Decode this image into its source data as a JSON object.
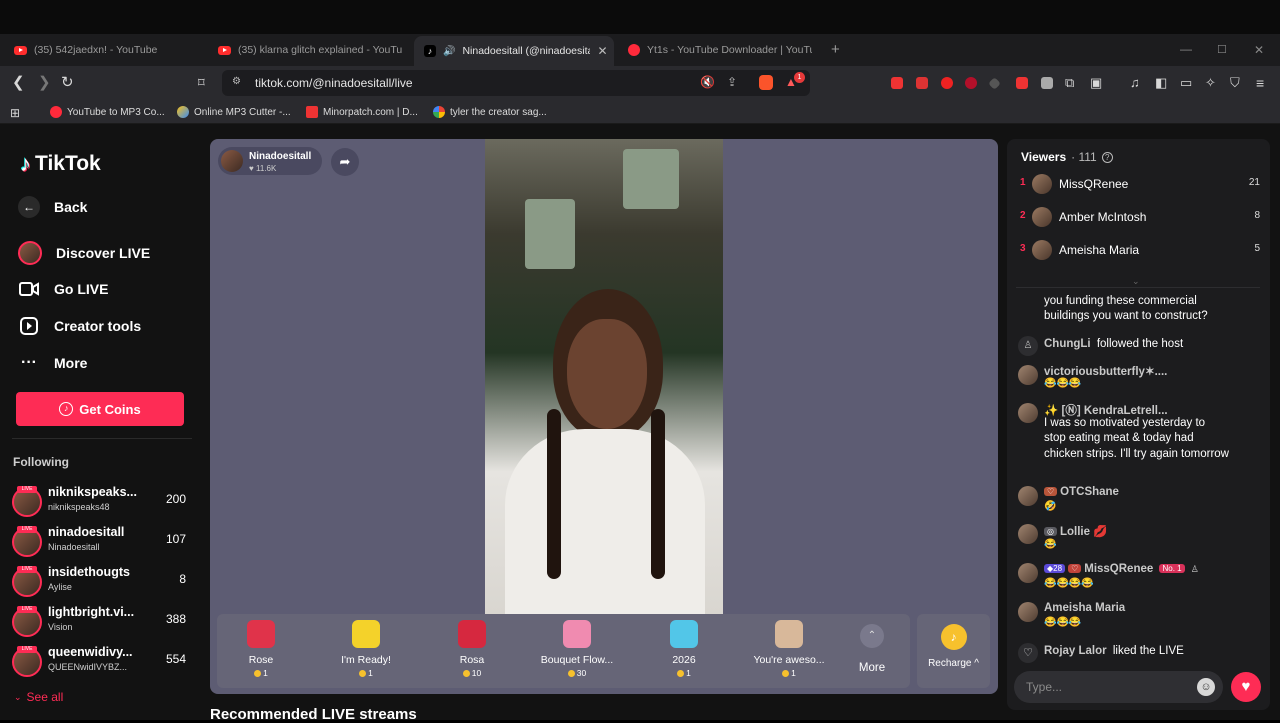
{
  "browser": {
    "tabs": [
      {
        "label": "(35) 542jaedxn! - YouTube"
      },
      {
        "label": "(35) klarna glitch explained - YouTube"
      },
      {
        "label": "Ninadoesitall (@ninadoesitall)"
      },
      {
        "label": "Yt1s - YouTube Downloader | YouTube"
      }
    ],
    "url": "tiktok.com/@ninadoesitall/live",
    "bookmarks": [
      {
        "label": "YouTube to MP3 Co..."
      },
      {
        "label": "Online MP3 Cutter -..."
      },
      {
        "label": "Minorpatch.com | D..."
      },
      {
        "label": "tyler the creator sag..."
      }
    ],
    "ext_badge": "1"
  },
  "sidebar": {
    "logo": "TikTok",
    "nav": [
      {
        "label": "Back"
      },
      {
        "label": "Discover LIVE"
      },
      {
        "label": "Go LIVE"
      },
      {
        "label": "Creator tools"
      },
      {
        "label": "More"
      }
    ],
    "coins_button": "Get Coins",
    "following_title": "Following",
    "following": [
      {
        "name": "niknikspeaks...",
        "sub": "niknikspeaks48",
        "count": "200"
      },
      {
        "name": "ninadoesitall",
        "sub": "Ninadoesitall",
        "count": "107"
      },
      {
        "name": "insidethougts",
        "sub": "Aylise",
        "count": "8"
      },
      {
        "name": "lightbright.vi...",
        "sub": "Vision",
        "count": "388"
      },
      {
        "name": "queenwidivy...",
        "sub": "QUEENwidIVYBZ...",
        "count": "554"
      }
    ],
    "see_all": "See all",
    "live_badge": "LIVE"
  },
  "stream": {
    "host_name": "Ninadoesitall",
    "host_likes": "11.6K",
    "gifts": [
      {
        "name": "Rose",
        "price": "1",
        "color": "#e0334a"
      },
      {
        "name": "I'm Ready!",
        "price": "1",
        "color": "#f4d22a"
      },
      {
        "name": "Rosa",
        "price": "10",
        "color": "#d6283f"
      },
      {
        "name": "Bouquet Flow...",
        "price": "30",
        "color": "#f08bb0"
      },
      {
        "name": "2026",
        "price": "1",
        "color": "#52c6e8"
      },
      {
        "name": "You're aweso...",
        "price": "1",
        "color": "#d8b89a"
      }
    ],
    "more_label": "More",
    "recharge_label": "Recharge ^",
    "recommended_title": "Recommended LIVE streams"
  },
  "viewers": {
    "title": "Viewers",
    "count": "· 111",
    "list": [
      {
        "rank": "1",
        "name": "MissQRenee",
        "score": "21"
      },
      {
        "rank": "2",
        "name": "Amber McIntosh",
        "score": "8"
      },
      {
        "rank": "3",
        "name": "Ameisha Maria",
        "score": "5"
      }
    ]
  },
  "chat": {
    "partial_message": "you funding these commercial buildings you want to construct?",
    "messages": [
      {
        "user": "ChungLi",
        "text": "followed the host"
      },
      {
        "user": "victoriousbutterfly✶....",
        "text": "😂😂😂"
      },
      {
        "user": "✨ [Ⓝ] KendraLetrell...",
        "text": "I was so motivated yesterday to stop eating meat & today had chicken strips. I'll try again tomorrow"
      },
      {
        "user": "OTCShane",
        "text": "🤣"
      },
      {
        "user": "Lollie 💋",
        "text": "😂"
      },
      {
        "user": "MissQRenee",
        "text": "😂😂😂😂",
        "level": "28",
        "rank_badge": "No. 1"
      },
      {
        "user": "Ameisha Maria",
        "text": "😂😂😂"
      },
      {
        "user": "Rojay Lalor",
        "text": "liked the LIVE"
      }
    ],
    "input_placeholder": "Type..."
  }
}
